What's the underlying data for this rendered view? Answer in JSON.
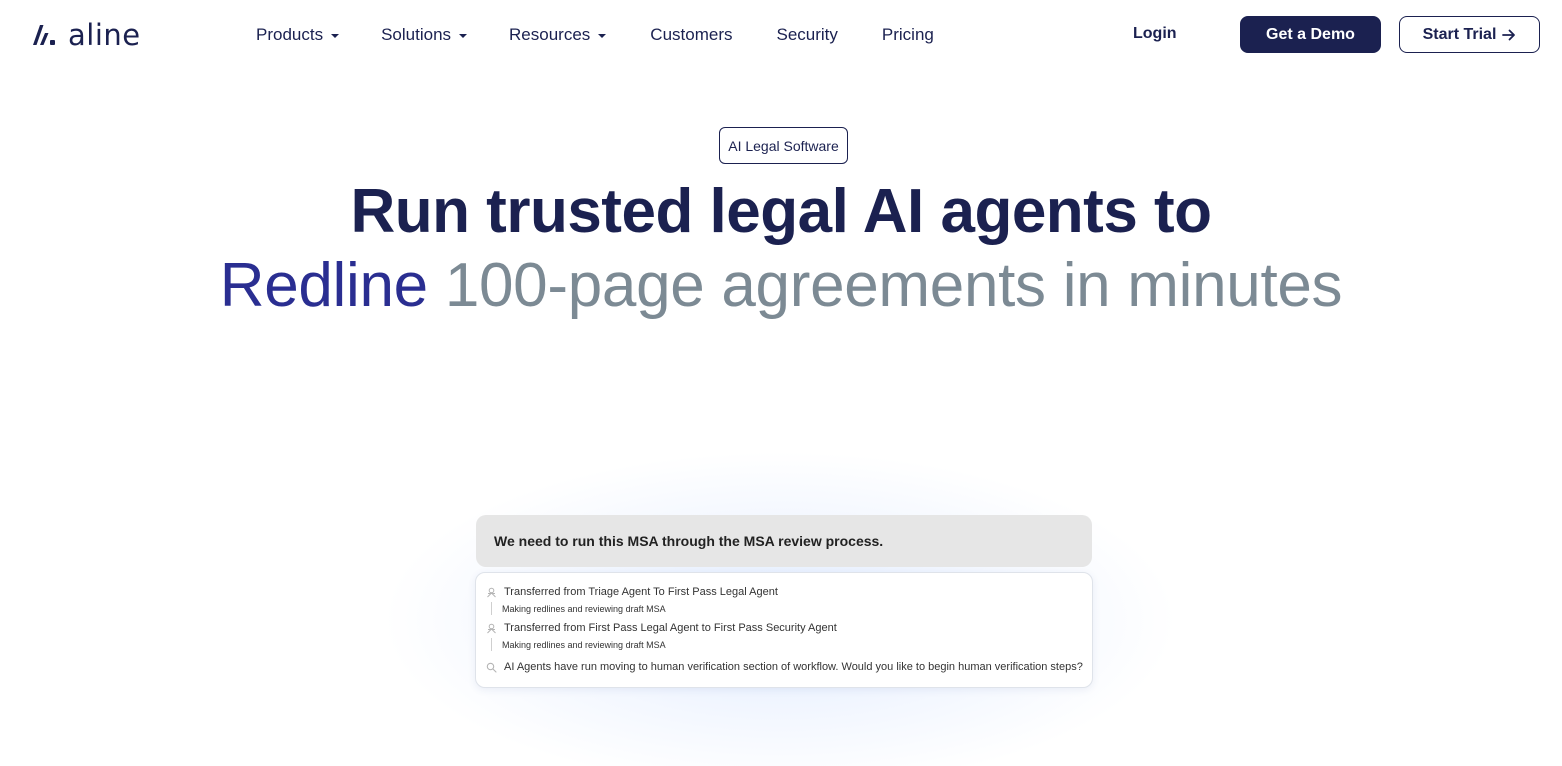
{
  "brand": {
    "name": "aline",
    "logo_icon": "aline-mark-icon"
  },
  "nav": {
    "items": [
      {
        "label": "Products",
        "has_dropdown": true
      },
      {
        "label": "Solutions",
        "has_dropdown": true
      },
      {
        "label": "Resources",
        "has_dropdown": true
      },
      {
        "label": "Customers",
        "has_dropdown": false
      },
      {
        "label": "Security",
        "has_dropdown": false
      },
      {
        "label": "Pricing",
        "has_dropdown": false
      }
    ],
    "login_label": "Login",
    "demo_label": "Get a Demo",
    "trial_label": "Start Trial",
    "trial_icon": "arrow-right-icon"
  },
  "hero": {
    "badge": "AI Legal Software",
    "headline_line1": "Run trusted legal AI agents to",
    "headline_accent": "Redline",
    "headline_rest": "100-page agreements in minutes"
  },
  "demo": {
    "prompt": "We need to run this MSA through the MSA review process.",
    "log": [
      {
        "type": "transfer",
        "icon": "agent-icon",
        "text": "Transferred from Triage Agent To First Pass Legal Agent"
      },
      {
        "type": "sub",
        "text": "Making redlines and reviewing draft MSA"
      },
      {
        "type": "transfer",
        "icon": "agent-icon",
        "text": "Transferred from First Pass Legal Agent to First Pass Security Agent"
      },
      {
        "type": "sub",
        "text": "Making redlines and reviewing draft MSA"
      },
      {
        "type": "status",
        "icon": "search-icon",
        "text": "AI Agents have run moving to human verification section of workflow. Would you like to begin human verification steps?"
      }
    ]
  },
  "colors": {
    "navy": "#1b2150",
    "accent": "#2a2e91",
    "muted": "#7c8a94",
    "prompt_bg": "#e6e6e6"
  }
}
